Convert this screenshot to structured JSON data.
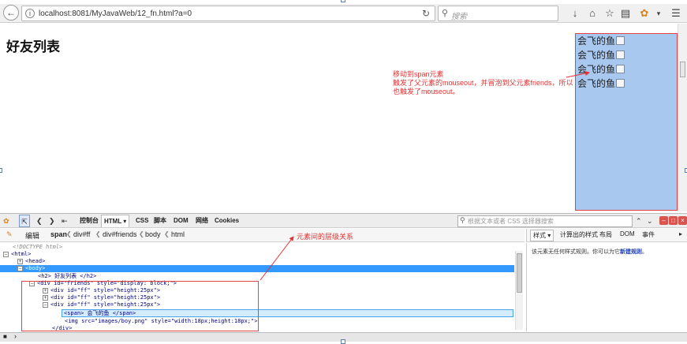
{
  "browser": {
    "url": "localhost:8081/MyJavaWeb/12_fn.html?a=0",
    "search_placeholder": "搜索"
  },
  "page": {
    "title": "好友列表",
    "friends": [
      "会飞的鱼",
      "会飞的鱼",
      "会飞的鱼",
      "会飞的鱼"
    ],
    "note_lines": [
      "移动到span元素",
      "触发了父元素的mouseout，并冒泡到父元素friends，所以",
      "也触发了mouseout。"
    ]
  },
  "devtools": {
    "tabs": [
      "控制台",
      "HTML",
      "CSS",
      "脚本",
      "DOM",
      "网络",
      "Cookies"
    ],
    "search_placeholder": "根据文本或者 CSS 选择器搜索",
    "edit_label": "编辑",
    "breadcrumbs": [
      "span",
      "div#ff",
      "div#friends",
      "body",
      "html"
    ],
    "side_tabs": [
      "样式",
      "计算出的样式",
      "布局",
      "DOM",
      "事件"
    ],
    "side_text_prefix": "该元素无任何样式规则。你可以为它",
    "side_text_link": "新建规则",
    "side_text_suffix": "。",
    "annotation_label": "元素间的层级关系",
    "code": [
      "<!DOCTYPE html>",
      "<html>",
      "<head>",
      "<body>",
      "<h2> 好友列表 </h2>",
      "<div id=\"friends\" style=\"display: block;\">",
      "<div id=\"ff\" style=\"height:25px\">",
      "<div id=\"ff\" style=\"height:25px\">",
      "<div id=\"ff\" style=\"height:25px\">",
      "<span> 会飞的鱼 </span>",
      "<img src=\"images/boy.png\" style=\"width:18px;height:18px;\">",
      "</div>"
    ]
  }
}
